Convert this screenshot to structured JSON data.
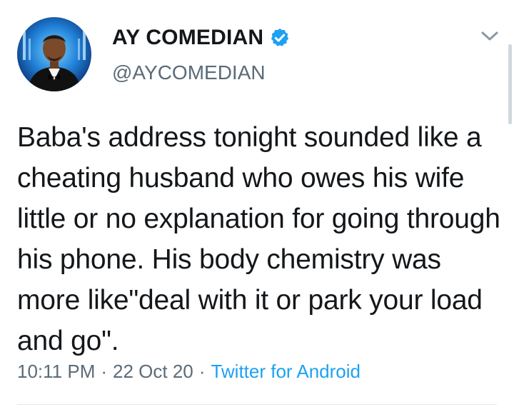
{
  "author": {
    "display_name": "AY COMEDIAN",
    "handle": "@AYCOMEDIAN",
    "verified": true,
    "avatar_icon": "profile-photo-icon"
  },
  "tweet": {
    "text": "Baba's address tonight sounded like a cheating husband who owes his wife little or no explanation for going through his phone. His body chemistry was more like\"deal with it or park your load and go\"."
  },
  "meta": {
    "time": "10:11 PM",
    "separator1": "·",
    "date": "22 Oct 20",
    "separator2": "·",
    "source": "Twitter for Android"
  },
  "colors": {
    "accent": "#1da1f2",
    "secondary_text": "#5b6b78",
    "text": "#14171a"
  }
}
